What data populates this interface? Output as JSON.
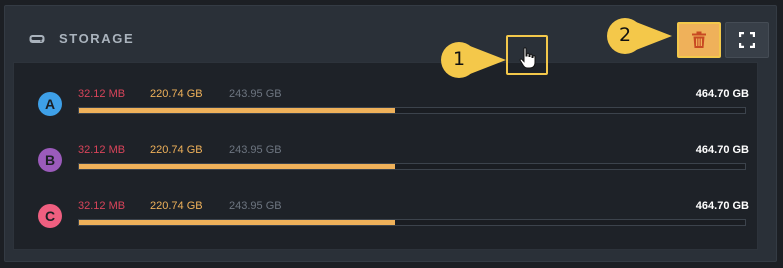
{
  "panel": {
    "title": "STORAGE",
    "icons": {
      "header": "hdd-icon",
      "trash": "trash-icon",
      "fullscreen": "fullscreen-icon",
      "cursor": "pointer-hand-icon"
    }
  },
  "colors": {
    "used": "#d8445a",
    "allocated": "#efb15a",
    "free": "#6d7580",
    "accent": "#efb15a",
    "highlight": "#f3c84b"
  },
  "drives": [
    {
      "letter": "A",
      "color": "#3ea0e8",
      "used": "32.12 MB",
      "allocated": "220.74 GB",
      "free": "243.95 GB",
      "total": "464.70 GB",
      "fill_fraction": 0.475
    },
    {
      "letter": "B",
      "color": "#9b5bbb",
      "used": "32.12 MB",
      "allocated": "220.74 GB",
      "free": "243.95 GB",
      "total": "464.70 GB",
      "fill_fraction": 0.475
    },
    {
      "letter": "C",
      "color": "#ef5f80",
      "used": "32.12 MB",
      "allocated": "220.74 GB",
      "free": "243.95 GB",
      "total": "464.70 GB",
      "fill_fraction": 0.475
    }
  ],
  "callouts": [
    {
      "number": "1"
    },
    {
      "number": "2"
    }
  ]
}
